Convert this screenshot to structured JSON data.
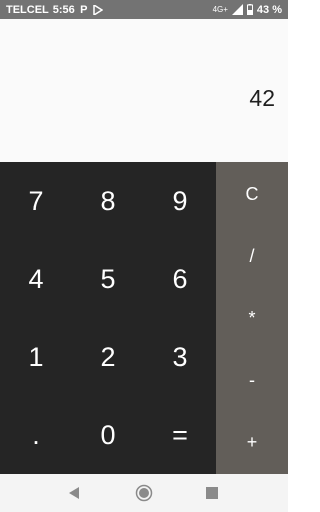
{
  "status_bar": {
    "carrier": "TELCEL",
    "time": "5:56",
    "network": "4G+",
    "battery": "43 %",
    "icons": [
      "p-icon",
      "play-store-icon",
      "signal-icon",
      "battery-icon"
    ]
  },
  "display": {
    "value": "42"
  },
  "keypad": {
    "keys": [
      "7",
      "8",
      "9",
      "4",
      "5",
      "6",
      "1",
      "2",
      "3",
      ".",
      "0",
      "="
    ]
  },
  "operators": {
    "clear": "C",
    "divide": "/",
    "multiply": "*",
    "subtract": "-",
    "add": "+"
  },
  "nav_bar": {
    "icons": [
      "back-icon",
      "home-icon",
      "recents-icon"
    ]
  },
  "colors": {
    "status_bar_bg": "#737373",
    "display_bg": "#fafafa",
    "keypad_bg": "#252525",
    "operator_bg": "#625e59",
    "nav_bar_bg": "#f4f4f4"
  }
}
